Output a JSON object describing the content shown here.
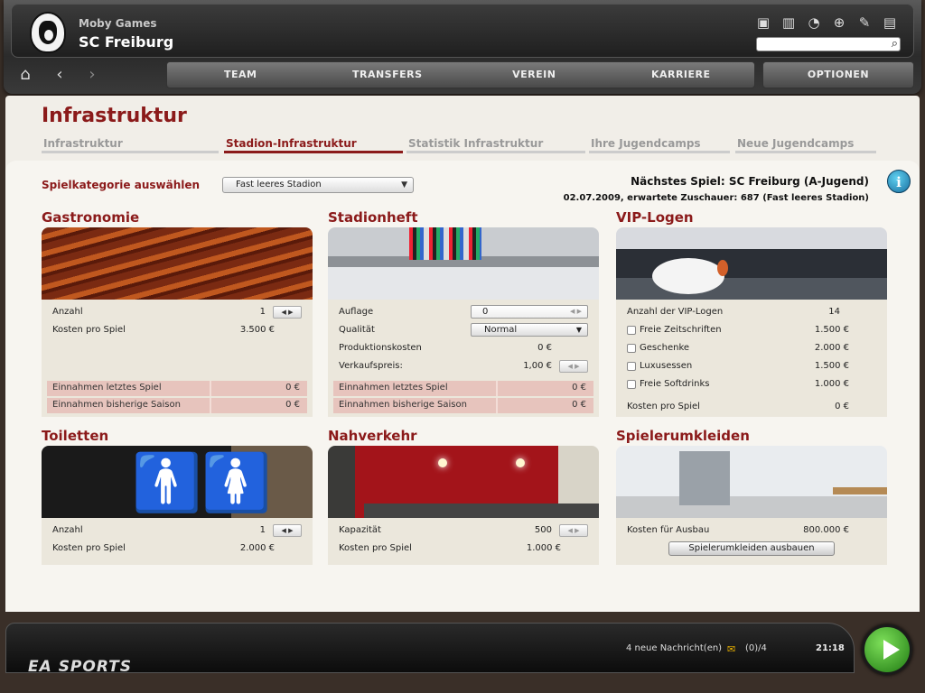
{
  "header": {
    "company": "Moby Games",
    "club": "SC Freiburg",
    "icons": [
      "window-icon",
      "stats-icon",
      "loading-icon",
      "globe-icon",
      "tools-icon",
      "document-icon"
    ]
  },
  "nav": {
    "menu": [
      "TEAM",
      "TRANSFERS",
      "VEREIN",
      "KARRIERE"
    ],
    "options": "OPTIONEN"
  },
  "page": {
    "title": "Infrastruktur",
    "tabs": [
      "Infrastruktur",
      "Stadion-Infrastruktur",
      "Statistik Infrastruktur",
      "Ihre Jugendcamps",
      "Neue Jugendcamps"
    ],
    "active_tab": "Stadion-Infrastruktur"
  },
  "category": {
    "label": "Spielkategorie auswählen",
    "selected": "Fast leeres Stadion"
  },
  "next_game": {
    "title": "Nächstes Spiel: SC Freiburg (A-Jugend)",
    "details": "02.07.2009, erwartete Zuschauer: 687 (Fast leeres Stadion)"
  },
  "gastronomie": {
    "title": "Gastronomie",
    "anzahl_label": "Anzahl",
    "anzahl": "1",
    "kosten_label": "Kosten pro Spiel",
    "kosten": "3.500 €",
    "income_last_label": "Einnahmen letztes Spiel",
    "income_last": "0 €",
    "income_season_label": "Einnahmen bisherige Saison",
    "income_season": "0 €"
  },
  "stadionheft": {
    "title": "Stadionheft",
    "auflage_label": "Auflage",
    "auflage": "0",
    "qualitaet_label": "Qualität",
    "qualitaet": "Normal",
    "prodkosten_label": "Produktionskosten",
    "prodkosten": "0 €",
    "verkaufspreis_label": "Verkaufspreis:",
    "verkaufspreis": "1,00 €",
    "income_last_label": "Einnahmen letztes Spiel",
    "income_last": "0 €",
    "income_season_label": "Einnahmen bisherige Saison",
    "income_season": "0 €"
  },
  "vip": {
    "title": "VIP-Logen",
    "anzahl_label": "Anzahl der VIP-Logen",
    "anzahl": "14",
    "options": [
      {
        "label": "Freie Zeitschriften",
        "price": "1.500 €"
      },
      {
        "label": "Geschenke",
        "price": "2.000 €"
      },
      {
        "label": "Luxusessen",
        "price": "1.500 €"
      },
      {
        "label": "Freie Softdrinks",
        "price": "1.000 €"
      }
    ],
    "kosten_label": "Kosten pro Spiel",
    "kosten": "0 €"
  },
  "toiletten": {
    "title": "Toiletten",
    "anzahl_label": "Anzahl",
    "anzahl": "1",
    "kosten_label": "Kosten pro Spiel",
    "kosten": "2.000 €"
  },
  "nahverkehr": {
    "title": "Nahverkehr",
    "kapazitaet_label": "Kapazität",
    "kapazitaet": "500",
    "kosten_label": "Kosten pro Spiel",
    "kosten": "1.000 €"
  },
  "umkleiden": {
    "title": "Spielerumkleiden",
    "ausbau_label": "Kosten für Ausbau",
    "ausbau": "800.000 €",
    "button": "Spielerumkleiden ausbauen"
  },
  "footer": {
    "brand": "EA SPORTS",
    "news": "4 neue Nachricht(en)",
    "mail_count": "(0)/4",
    "time": "21:18"
  },
  "colors": {
    "accent": "#8b1a1a",
    "income_bg": "#e7c4bd",
    "card_bg": "#ebe7dc"
  }
}
